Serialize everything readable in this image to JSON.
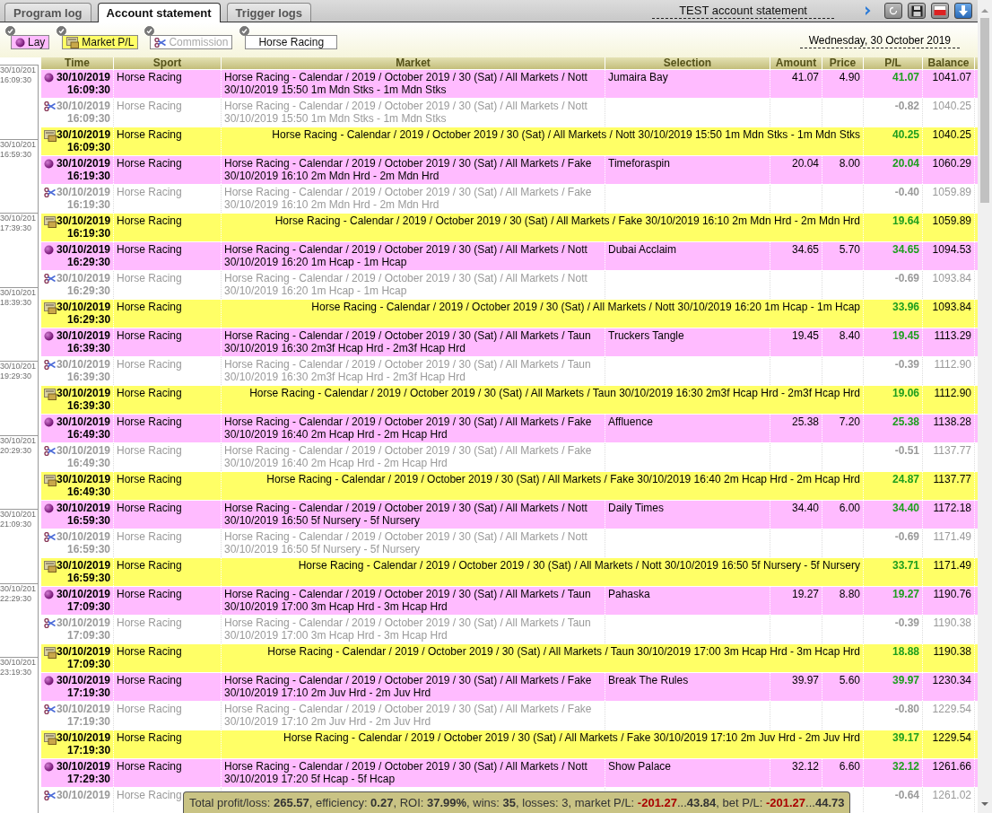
{
  "tabs": [
    {
      "label": "Program log",
      "selected": false
    },
    {
      "label": "Account statement",
      "selected": true
    },
    {
      "label": "Trigger logs",
      "selected": false
    }
  ],
  "account_title": "TEST account statement",
  "filters": [
    {
      "label": "Lay",
      "kind": "lay",
      "checked": true
    },
    {
      "label": "Market P/L",
      "kind": "market_pl",
      "checked": true
    },
    {
      "label": "Commission",
      "kind": "commission",
      "checked": true
    },
    {
      "label": "Horse Racing",
      "kind": "sport",
      "checked": true
    }
  ],
  "date": "Wednesday, 30 October 2019",
  "timeline": [
    {
      "date": "30/10/201",
      "time": "16:09:30"
    },
    {
      "date": "30/10/201",
      "time": "16:59:30"
    },
    {
      "date": "30/10/201",
      "time": "17:39:30"
    },
    {
      "date": "30/10/201",
      "time": "18:39:30"
    },
    {
      "date": "30/10/201",
      "time": "19:29:30"
    },
    {
      "date": "30/10/201",
      "time": "20:29:30"
    },
    {
      "date": "30/10/201",
      "time": "21:09:30"
    },
    {
      "date": "30/10/201",
      "time": "22:29:30"
    },
    {
      "date": "30/10/201",
      "time": "23:19:30"
    }
  ],
  "columns": [
    "Time",
    "Sport",
    "Market",
    "Selection",
    "Amount",
    "Price",
    "P/L",
    "Balance"
  ],
  "rows": [
    {
      "kind": "lay",
      "date": "30/10/2019",
      "clock": "16:09:30",
      "sport": "Horse Racing",
      "market": "Horse Racing - Calendar / 2019 / October 2019 / 30 (Sat) / All Markets / Nott 30/10/2019 15:50 1m Mdn Stks - 1m Mdn Stks",
      "selection": "Jumaira Bay",
      "amount": "41.07",
      "price": "4.90",
      "pl": "41.07",
      "balance": "1041.07"
    },
    {
      "kind": "commission",
      "date": "30/10/2019",
      "clock": "16:09:30",
      "sport": "Horse Racing",
      "market": "Horse Racing - Calendar / 2019 / October 2019 / 30 (Sat) / All Markets / Nott 30/10/2019 15:50 1m Mdn Stks - 1m Mdn Stks",
      "pl": "-0.82",
      "balance": "1040.25"
    },
    {
      "kind": "market_pl",
      "date": "30/10/2019",
      "clock": "16:09:30",
      "sport": "Horse Racing",
      "market": "Horse Racing - Calendar / 2019 / October 2019 / 30 (Sat) / All Markets / Nott 30/10/2019 15:50 1m Mdn Stks - 1m Mdn Stks",
      "pl": "40.25",
      "balance": "1040.25"
    },
    {
      "kind": "lay",
      "date": "30/10/2019",
      "clock": "16:19:30",
      "sport": "Horse Racing",
      "market": "Horse Racing - Calendar / 2019 / October 2019 / 30 (Sat) / All Markets / Fake 30/10/2019 16:10 2m Mdn Hrd - 2m Mdn Hrd",
      "selection": "Timeforaspin",
      "amount": "20.04",
      "price": "8.00",
      "pl": "20.04",
      "balance": "1060.29"
    },
    {
      "kind": "commission",
      "date": "30/10/2019",
      "clock": "16:19:30",
      "sport": "Horse Racing",
      "market": "Horse Racing - Calendar / 2019 / October 2019 / 30 (Sat) / All Markets / Fake 30/10/2019 16:10 2m Mdn Hrd - 2m Mdn Hrd",
      "pl": "-0.40",
      "balance": "1059.89"
    },
    {
      "kind": "market_pl",
      "date": "30/10/2019",
      "clock": "16:19:30",
      "sport": "Horse Racing",
      "market": "Horse Racing - Calendar / 2019 / October 2019 / 30 (Sat) / All Markets / Fake 30/10/2019 16:10 2m Mdn Hrd - 2m Mdn Hrd",
      "pl": "19.64",
      "balance": "1059.89"
    },
    {
      "kind": "lay",
      "date": "30/10/2019",
      "clock": "16:29:30",
      "sport": "Horse Racing",
      "market": "Horse Racing - Calendar / 2019 / October 2019 / 30 (Sat) / All Markets / Nott 30/10/2019 16:20 1m Hcap - 1m Hcap",
      "selection": "Dubai Acclaim",
      "amount": "34.65",
      "price": "5.70",
      "pl": "34.65",
      "balance": "1094.53"
    },
    {
      "kind": "commission",
      "date": "30/10/2019",
      "clock": "16:29:30",
      "sport": "Horse Racing",
      "market": "Horse Racing - Calendar / 2019 / October 2019 / 30 (Sat) / All Markets / Nott 30/10/2019 16:20 1m Hcap - 1m Hcap",
      "pl": "-0.69",
      "balance": "1093.84"
    },
    {
      "kind": "market_pl",
      "date": "30/10/2019",
      "clock": "16:29:30",
      "sport": "Horse Racing",
      "market": "Horse Racing - Calendar / 2019 / October 2019 / 30 (Sat) / All Markets / Nott 30/10/2019 16:20 1m Hcap - 1m Hcap",
      "pl": "33.96",
      "balance": "1093.84"
    },
    {
      "kind": "lay",
      "date": "30/10/2019",
      "clock": "16:39:30",
      "sport": "Horse Racing",
      "market": "Horse Racing - Calendar / 2019 / October 2019 / 30 (Sat) / All Markets / Taun 30/10/2019 16:30 2m3f Hcap Hrd - 2m3f Hcap Hrd",
      "selection": "Truckers Tangle",
      "amount": "19.45",
      "price": "8.40",
      "pl": "19.45",
      "balance": "1113.29"
    },
    {
      "kind": "commission",
      "date": "30/10/2019",
      "clock": "16:39:30",
      "sport": "Horse Racing",
      "market": "Horse Racing - Calendar / 2019 / October 2019 / 30 (Sat) / All Markets / Taun 30/10/2019 16:30 2m3f Hcap Hrd - 2m3f Hcap Hrd",
      "pl": "-0.39",
      "balance": "1112.90"
    },
    {
      "kind": "market_pl",
      "date": "30/10/2019",
      "clock": "16:39:30",
      "sport": "Horse Racing",
      "market": "Horse Racing - Calendar / 2019 / October 2019 / 30 (Sat) / All Markets / Taun 30/10/2019 16:30 2m3f Hcap Hrd - 2m3f Hcap Hrd",
      "pl": "19.06",
      "balance": "1112.90"
    },
    {
      "kind": "lay",
      "date": "30/10/2019",
      "clock": "16:49:30",
      "sport": "Horse Racing",
      "market": "Horse Racing - Calendar / 2019 / October 2019 / 30 (Sat) / All Markets / Fake 30/10/2019 16:40 2m Hcap Hrd - 2m Hcap Hrd",
      "selection": "Affluence",
      "amount": "25.38",
      "price": "7.20",
      "pl": "25.38",
      "balance": "1138.28"
    },
    {
      "kind": "commission",
      "date": "30/10/2019",
      "clock": "16:49:30",
      "sport": "Horse Racing",
      "market": "Horse Racing - Calendar / 2019 / October 2019 / 30 (Sat) / All Markets / Fake 30/10/2019 16:40 2m Hcap Hrd - 2m Hcap Hrd",
      "pl": "-0.51",
      "balance": "1137.77"
    },
    {
      "kind": "market_pl",
      "date": "30/10/2019",
      "clock": "16:49:30",
      "sport": "Horse Racing",
      "market": "Horse Racing - Calendar / 2019 / October 2019 / 30 (Sat) / All Markets / Fake 30/10/2019 16:40 2m Hcap Hrd - 2m Hcap Hrd",
      "pl": "24.87",
      "balance": "1137.77"
    },
    {
      "kind": "lay",
      "date": "30/10/2019",
      "clock": "16:59:30",
      "sport": "Horse Racing",
      "market": "Horse Racing - Calendar / 2019 / October 2019 / 30 (Sat) / All Markets / Nott 30/10/2019 16:50 5f Nursery - 5f Nursery",
      "selection": "Daily Times",
      "amount": "34.40",
      "price": "6.00",
      "pl": "34.40",
      "balance": "1172.18"
    },
    {
      "kind": "commission",
      "date": "30/10/2019",
      "clock": "16:59:30",
      "sport": "Horse Racing",
      "market": "Horse Racing - Calendar / 2019 / October 2019 / 30 (Sat) / All Markets / Nott 30/10/2019 16:50 5f Nursery - 5f Nursery",
      "pl": "-0.69",
      "balance": "1171.49"
    },
    {
      "kind": "market_pl",
      "date": "30/10/2019",
      "clock": "16:59:30",
      "sport": "Horse Racing",
      "market": "Horse Racing - Calendar / 2019 / October 2019 / 30 (Sat) / All Markets / Nott 30/10/2019 16:50 5f Nursery - 5f Nursery",
      "pl": "33.71",
      "balance": "1171.49"
    },
    {
      "kind": "lay",
      "date": "30/10/2019",
      "clock": "17:09:30",
      "sport": "Horse Racing",
      "market": "Horse Racing - Calendar / 2019 / October 2019 / 30 (Sat) / All Markets / Taun 30/10/2019 17:00 3m Hcap Hrd - 3m Hcap Hrd",
      "selection": "Pahaska",
      "amount": "19.27",
      "price": "8.80",
      "pl": "19.27",
      "balance": "1190.76"
    },
    {
      "kind": "commission",
      "date": "30/10/2019",
      "clock": "17:09:30",
      "sport": "Horse Racing",
      "market": "Horse Racing - Calendar / 2019 / October 2019 / 30 (Sat) / All Markets / Taun 30/10/2019 17:00 3m Hcap Hrd - 3m Hcap Hrd",
      "pl": "-0.39",
      "balance": "1190.38"
    },
    {
      "kind": "market_pl",
      "date": "30/10/2019",
      "clock": "17:09:30",
      "sport": "Horse Racing",
      "market": "Horse Racing - Calendar / 2019 / October 2019 / 30 (Sat) / All Markets / Taun 30/10/2019 17:00 3m Hcap Hrd - 3m Hcap Hrd",
      "pl": "18.88",
      "balance": "1190.38"
    },
    {
      "kind": "lay",
      "date": "30/10/2019",
      "clock": "17:19:30",
      "sport": "Horse Racing",
      "market": "Horse Racing - Calendar / 2019 / October 2019 / 30 (Sat) / All Markets / Fake 30/10/2019 17:10 2m Juv Hrd - 2m Juv Hrd",
      "selection": "Break The Rules",
      "amount": "39.97",
      "price": "5.60",
      "pl": "39.97",
      "balance": "1230.34"
    },
    {
      "kind": "commission",
      "date": "30/10/2019",
      "clock": "17:19:30",
      "sport": "Horse Racing",
      "market": "Horse Racing - Calendar / 2019 / October 2019 / 30 (Sat) / All Markets / Fake 30/10/2019 17:10 2m Juv Hrd - 2m Juv Hrd",
      "pl": "-0.80",
      "balance": "1229.54"
    },
    {
      "kind": "market_pl",
      "date": "30/10/2019",
      "clock": "17:19:30",
      "sport": "Horse Racing",
      "market": "Horse Racing - Calendar / 2019 / October 2019 / 30 (Sat) / All Markets / Fake 30/10/2019 17:10 2m Juv Hrd - 2m Juv Hrd",
      "pl": "39.17",
      "balance": "1229.54"
    },
    {
      "kind": "lay",
      "date": "30/10/2019",
      "clock": "17:29:30",
      "sport": "Horse Racing",
      "market": "Horse Racing - Calendar / 2019 / October 2019 / 30 (Sat) / All Markets / Nott 30/10/2019 17:20 5f Hcap - 5f Hcap",
      "selection": "Show Palace",
      "amount": "32.12",
      "price": "6.60",
      "pl": "32.12",
      "balance": "1261.66"
    },
    {
      "kind": "commission",
      "date": "30/10/2019",
      "sport": "Horse Racing",
      "pl": "-0.64",
      "balance": "1261.02"
    }
  ],
  "summary": [
    {
      "text": "Total profit/loss: ",
      "kind": "label"
    },
    {
      "text": "265.57",
      "kind": "value"
    },
    {
      "text": ", efficiency: ",
      "kind": "label"
    },
    {
      "text": "0.27",
      "kind": "value"
    },
    {
      "text": ", ROI: ",
      "kind": "label"
    },
    {
      "text": "37.99%",
      "kind": "value"
    },
    {
      "text": ", wins: ",
      "kind": "label"
    },
    {
      "text": "35",
      "kind": "value"
    },
    {
      "text": ", losses: 3, market P/L: ",
      "kind": "label"
    },
    {
      "text": "-201.27",
      "kind": "loss"
    },
    {
      "text": "...",
      "kind": "label"
    },
    {
      "text": "43.84",
      "kind": "value"
    },
    {
      "text": ", bet P/L: ",
      "kind": "label"
    },
    {
      "text": "-201.27",
      "kind": "loss"
    },
    {
      "text": "...",
      "kind": "label"
    },
    {
      "text": "44.73",
      "kind": "value"
    }
  ]
}
